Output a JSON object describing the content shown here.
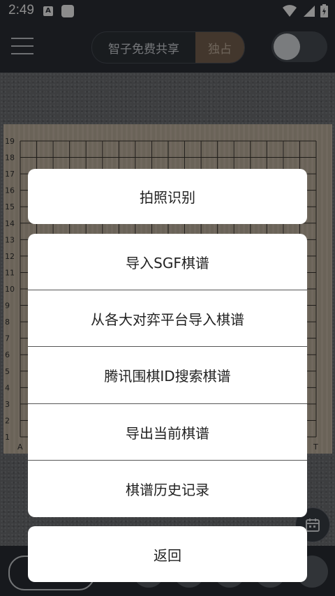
{
  "status_bar": {
    "time": "2:49",
    "notif_icon_letter": "A"
  },
  "header": {
    "segment_option_1": "智子免费共享",
    "segment_option_2": "独占"
  },
  "board": {
    "row_labels": [
      "19",
      "18",
      "17",
      "16",
      "15",
      "14",
      "13",
      "12",
      "11",
      "10",
      "9",
      "8",
      "7",
      "6",
      "5",
      "4",
      "3",
      "2",
      "1"
    ],
    "col_label_left": "A",
    "col_label_right": "T",
    "size": 19
  },
  "action_sheet": {
    "photo_recognize": "拍照识别",
    "import_sgf": "导入SGF棋谱",
    "import_platforms": "从各大对弈平台导入棋谱",
    "tencent_search": "腾讯围棋ID搜索棋谱",
    "export_current": "导出当前棋谱",
    "history": "棋谱历史记录",
    "back": "返回"
  },
  "colors": {
    "accent": "#7a6552",
    "dark_bg": "#2c3038"
  },
  "icons": [
    "menu-icon",
    "wifi-icon",
    "signal-icon",
    "battery-icon",
    "calendar-icon",
    "chevron-right-icon"
  ]
}
